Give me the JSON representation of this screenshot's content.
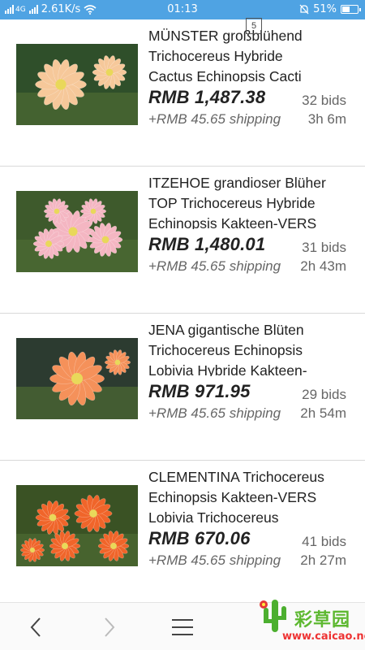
{
  "status_bar": {
    "network": "4G",
    "speed": "2.61K/s",
    "time": "01:13",
    "battery": "51%",
    "battery_level": 0.51
  },
  "listings": [
    {
      "title": "MÜNSTER großblühend\nTrichocereus Hybride\nCactus Echinopsis Cacti",
      "price": "RMB 1,487.38",
      "bids": "32 bids",
      "shipping": "+RMB 45.65 shipping",
      "time_left": "3h 6m",
      "flower_color": "#f6c89a"
    },
    {
      "title": "ITZEHOE grandioser Blüher\nTOP Trichocereus Hybride\nEchinopsis Kakteen-VERS",
      "price": "RMB 1,480.01",
      "bids": "31 bids",
      "shipping": "+RMB 45.65 shipping",
      "time_left": "2h 43m",
      "flower_color": "#f4b6c2"
    },
    {
      "title": "JENA gigantische Blüten\nTrichocereus Echinopsis\nLobivia Hybride Kakteen-",
      "price": "RMB 971.95",
      "bids": "29 bids",
      "shipping": "+RMB 45.65 shipping",
      "time_left": "2h 54m",
      "flower_color": "#f5915a"
    },
    {
      "title": "CLEMENTINA Trichocereus\nEchinopsis Kakteen-VERS\nLobivia Trichocereus",
      "price": "RMB 670.06",
      "bids": "41 bids",
      "shipping": "+RMB 45.65 shipping",
      "time_left": "2h 27m",
      "flower_color": "#f0652a"
    }
  ],
  "nav": {
    "back_icon": "chevron-left-icon",
    "forward_icon": "chevron-right-icon",
    "menu_icon": "hamburger-icon",
    "tab_count": "5"
  },
  "watermark": {
    "text_cn": "彩草园",
    "url": "www.caicao.net"
  }
}
